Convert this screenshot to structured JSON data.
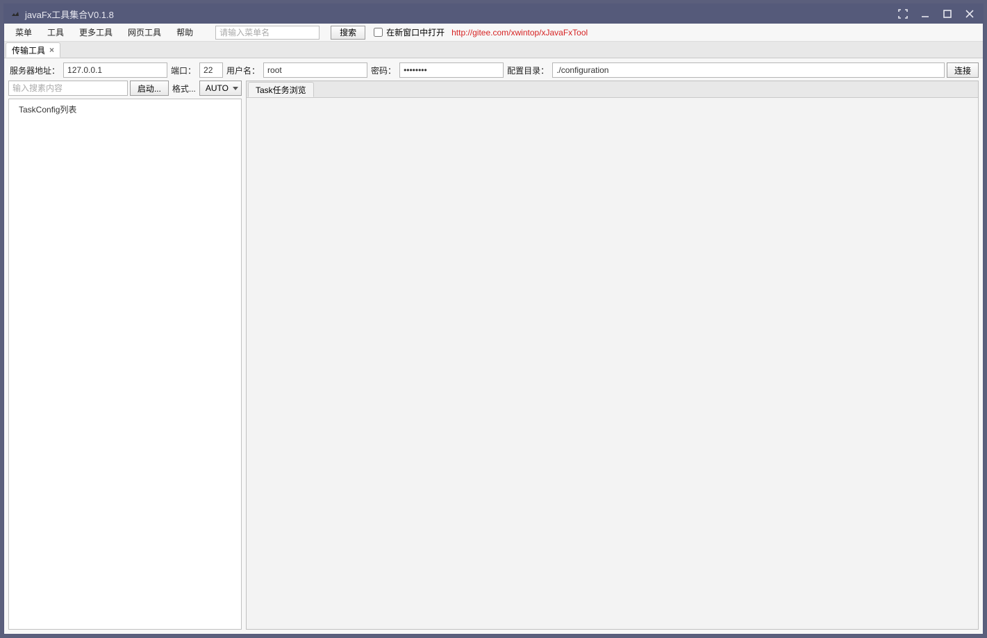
{
  "window": {
    "title": "javaFx工具集合V0.1.8"
  },
  "menubar": {
    "items": [
      "菜单",
      "工具",
      "更多工具",
      "网页工具",
      "帮助"
    ],
    "search_placeholder": "请输入菜单名",
    "search_button": "搜索",
    "open_new_window": "在新窗口中打开",
    "link": "http://gitee.com/xwintop/xJavaFxTool"
  },
  "tab": {
    "label": "传输工具",
    "close": "×"
  },
  "conn": {
    "server_label": "服务器地址：",
    "server_value": "127.0.0.1",
    "port_label": "端口：",
    "port_value": "22",
    "user_label": "用户名：",
    "user_value": "root",
    "pass_label": "密码：",
    "pass_value": "••••••••",
    "dir_label": "配置目录：",
    "dir_value": "./configuration",
    "connect_button": "连接"
  },
  "left": {
    "search_placeholder": "输入搜素内容",
    "start_button": "启动...",
    "format_label": "格式...",
    "auto_label": "AUTO",
    "tree_root": "TaskConfig列表"
  },
  "right": {
    "tab_label": "Task任务浏览"
  }
}
